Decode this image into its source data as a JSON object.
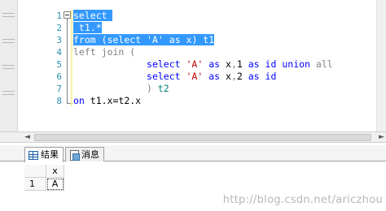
{
  "editor": {
    "line_numbers": [
      "1",
      "2",
      "3",
      "4",
      "5",
      "6",
      "7",
      "8",
      "9"
    ],
    "lines": {
      "l2": {
        "kw": "select",
        "pad": " "
      },
      "l3": {
        "text": " t1.*"
      },
      "l4": {
        "kw1": "from",
        "p1": " (",
        "kw2": "select",
        "sp1": " ",
        "str": "'A'",
        "sp2": " ",
        "kw3": "as",
        "rest": " x) t1"
      },
      "l5": {
        "kw1": "left",
        "sp": " ",
        "kw2": "join",
        "rest": " ("
      },
      "l6": {
        "indent": "             ",
        "kw1": "select",
        "sp1": " ",
        "str": "'A'",
        "sp2": " ",
        "kw2": "as",
        "mid": " x",
        "comma": ",",
        "num": "1",
        "sp3": " ",
        "kw3": "as",
        "sp4": " ",
        "kw4": "id",
        "sp5": " ",
        "kw5": "union",
        "sp6": " ",
        "kw6": "all"
      },
      "l7": {
        "indent": "             ",
        "kw1": "select",
        "sp1": " ",
        "str": "'A'",
        "sp2": " ",
        "kw2": "as",
        "mid": " x",
        "comma": ",",
        "num": "2",
        "sp3": " ",
        "kw3": "as",
        "sp4": " ",
        "kw4": "id"
      },
      "l8": {
        "indent": "             ",
        "paren": ")",
        "alias": " t2"
      },
      "l9": {
        "kw": "on",
        "rest": " t1.x=t2.x"
      }
    }
  },
  "scroll": {
    "left_arrow": "◄",
    "right_arrow": "►"
  },
  "results": {
    "tabs": [
      {
        "label": "结果",
        "icon": "grid-icon",
        "active": true
      },
      {
        "label": "消息",
        "icon": "message-icon",
        "active": false
      }
    ],
    "columns": [
      "x"
    ],
    "rows": [
      {
        "num": "1",
        "values": [
          "A"
        ]
      }
    ]
  },
  "watermark": "http://blog.csdn.net/ariczhou"
}
